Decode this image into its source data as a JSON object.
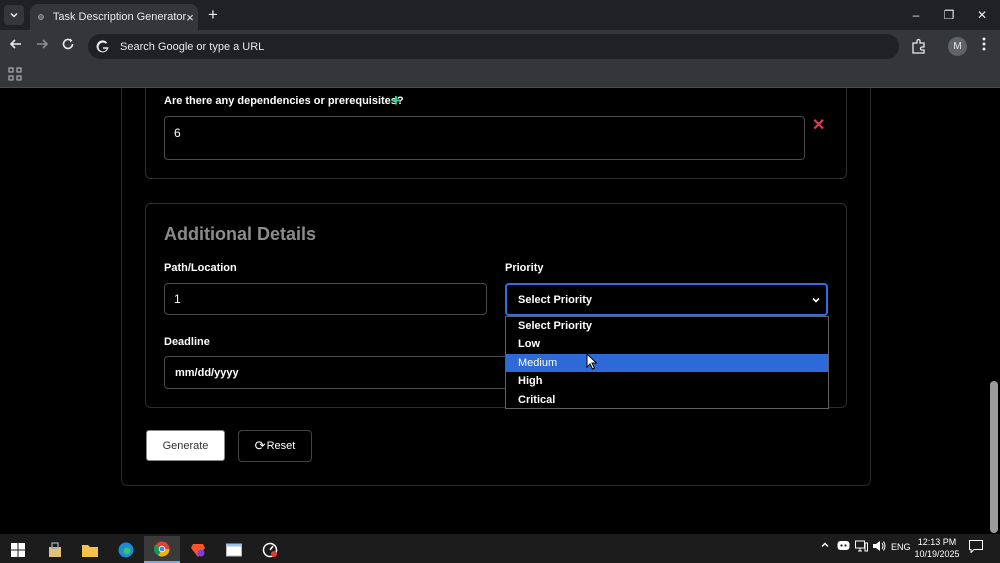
{
  "browser": {
    "tab_title": "Task Description Generator",
    "tab_close": "×",
    "new_tab": "+",
    "omnibox_placeholder": "Search Google or type a URL",
    "profile_initial": "M",
    "window_controls": {
      "minimize": "–",
      "restore": "❐",
      "close": "✕"
    }
  },
  "dependencies": {
    "label": "Are there any dependencies or prerequisites?",
    "add_icon": "+",
    "value": "6",
    "remove_icon": "✕"
  },
  "details": {
    "title": "Additional Details",
    "path_label": "Path/Location",
    "path_value": "1",
    "priority_label": "Priority",
    "priority_selected": "Select Priority",
    "priority_options": [
      "Select Priority",
      "Low",
      "Medium",
      "High",
      "Critical"
    ],
    "priority_highlighted": "Medium",
    "deadline_label": "Deadline",
    "deadline_placeholder": "mm/dd/yyyy"
  },
  "actions": {
    "generate": "Generate",
    "reset": "Reset",
    "reset_icon": "⟳"
  },
  "taskbar": {
    "lang": "ENG",
    "time": "12:13 PM",
    "date": "10/19/2025"
  },
  "colors": {
    "accent_green": "#3ecf8e",
    "remove_red": "#e53950",
    "select_blue": "#2d6ad8"
  }
}
